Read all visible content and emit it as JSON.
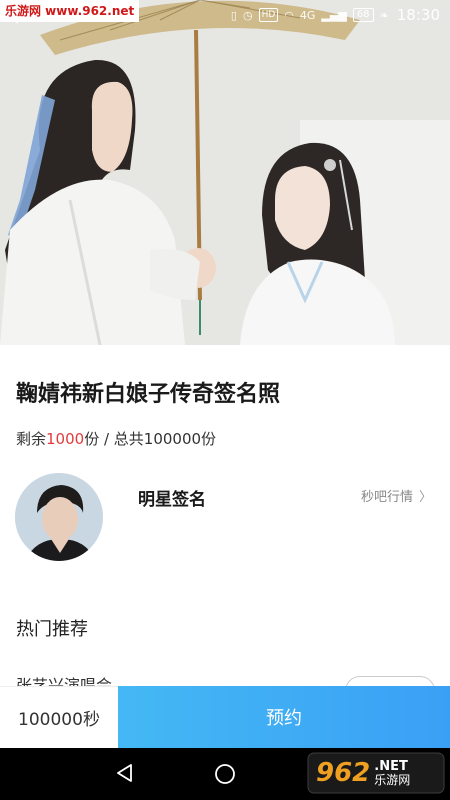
{
  "watermark_top": "乐游网 www.962.net",
  "status_bar": {
    "hd": "HD",
    "net": "4G",
    "battery": "68",
    "time": "18:30"
  },
  "product": {
    "title": "鞠婧祎新白娘子传奇签名照",
    "stock_prefix": "剩余",
    "stock_remaining": "1000",
    "stock_suffix": "份 / 总共100000份"
  },
  "seller": {
    "name": "明星签名",
    "link_label": "秒吧行情"
  },
  "recommend": {
    "section_title": "热门推荐",
    "first_item_partial": "张艺兴演唱会"
  },
  "action_bar": {
    "countdown": "100000秒",
    "reserve_label": "预约"
  },
  "watermark_logo": {
    "number": "962",
    "net": ".NET",
    "site": "乐游网"
  },
  "colors": {
    "accent": "#3aa0f5",
    "highlight": "#e23b3b"
  }
}
